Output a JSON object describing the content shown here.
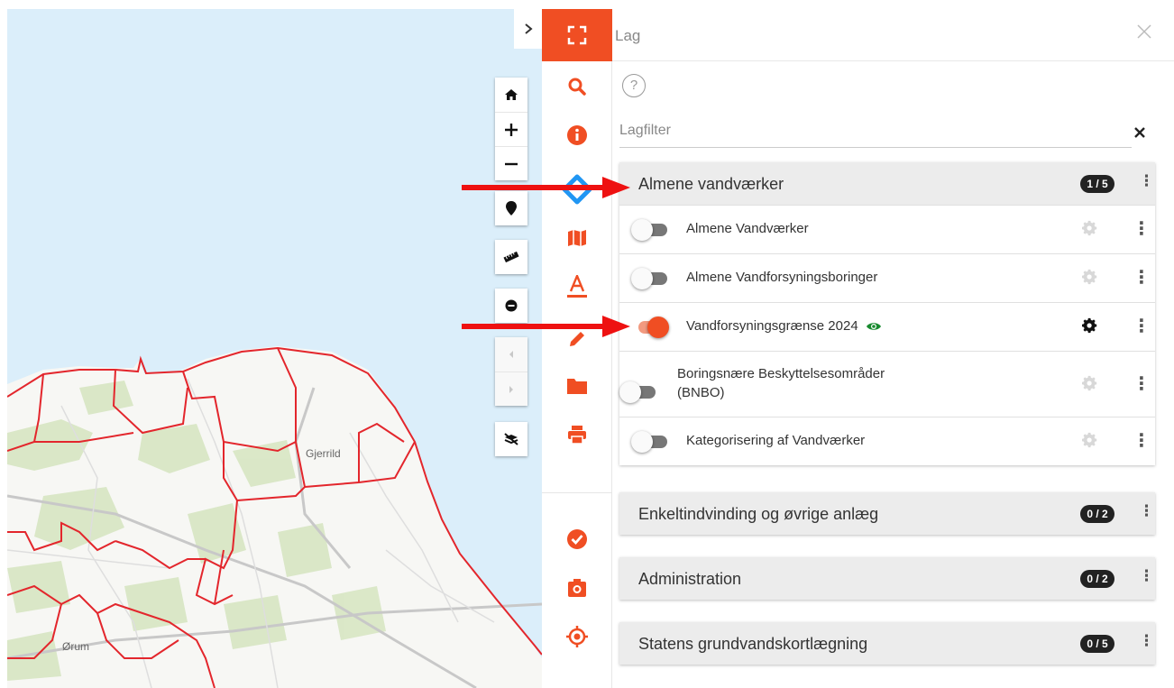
{
  "map": {
    "places": [
      "Gjerrild",
      "Ørum"
    ]
  },
  "map_tools": {
    "collapse_icon": "chevron-right-icon",
    "icons": [
      "home-icon",
      "zoom-in-icon",
      "zoom-out-icon",
      "marker-icon",
      "ruler-icon",
      "minus-circle-icon",
      "history-back-icon",
      "history-forward-icon",
      "layers-hidden-icon"
    ]
  },
  "sidebar": {
    "icons": [
      "fullscreen-icon",
      "search-icon",
      "info-icon",
      "layers-icon",
      "map-icon",
      "text-icon",
      "draw-icon",
      "folder-icon",
      "print-icon",
      "check-icon",
      "camera-icon",
      "location-target-icon"
    ],
    "accent": "#f04e23",
    "active_color": "#2196f3"
  },
  "panel": {
    "title": "Lag",
    "filter_placeholder": "Lagfilter",
    "groups": [
      {
        "name": "Almene vandværker",
        "badge": "1 / 5",
        "layers": [
          {
            "name": "Almene Vandværker",
            "on": false
          },
          {
            "name": "Almene Vandforsyningsboringer",
            "on": false
          },
          {
            "name": "Vandforsyningsgrænse 2024",
            "on": true
          },
          {
            "name_line1": "Boringsnære Beskyttelsesområder",
            "name_line2": "(BNBO)",
            "on": false
          },
          {
            "name": "Kategorisering af Vandværker",
            "on": false
          }
        ]
      },
      {
        "name": "Enkeltindvinding og øvrige anlæg",
        "badge": "0 / 2"
      },
      {
        "name": "Administration",
        "badge": "0 / 2"
      },
      {
        "name": "Statens grundvandskortlægning",
        "badge": "0 / 5"
      }
    ]
  },
  "colors": {
    "map_sea": "#dbeefa",
    "map_land": "#f7f7f4",
    "map_green": "#d7e6c3",
    "boundary": "#e3262c",
    "arrow": "#ee1111"
  }
}
